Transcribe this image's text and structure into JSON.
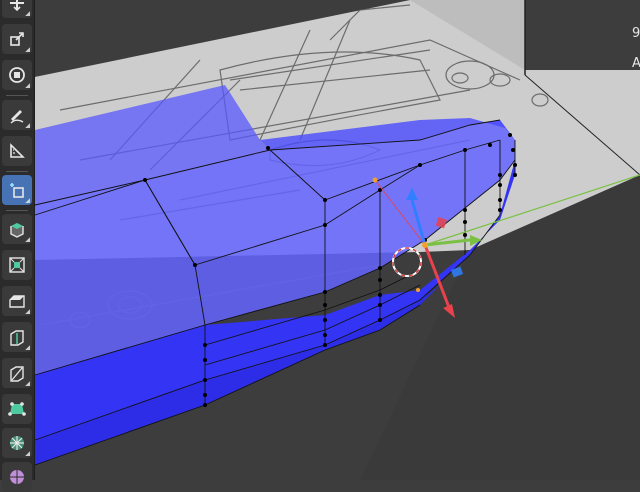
{
  "app": {
    "name": "3D viewport"
  },
  "colors": {
    "viewport_bg": "#3d3d3d",
    "mesh_face": "#3a3aff",
    "mesh_face_light": "#6e6eff",
    "reference_plane": "#cfcfcf",
    "axis_x": "#e8424c",
    "axis_y": "#7ac143",
    "axis_z": "#2f7fff",
    "toolbar_bg": "#2b2b2b",
    "tool_active": "#4772b3"
  },
  "toolbar": {
    "tools": [
      {
        "name": "move-icon",
        "active": false
      },
      {
        "name": "scale-icon",
        "active": false
      },
      {
        "name": "transform-icon",
        "active": false
      },
      {
        "name": "annotate-icon",
        "active": false
      },
      {
        "name": "measure-icon",
        "active": false
      },
      {
        "name": "add-cube-icon",
        "active": true
      },
      {
        "name": "extrude-icon",
        "active": false
      },
      {
        "name": "inset-icon",
        "active": false
      },
      {
        "name": "bevel-icon",
        "active": false
      },
      {
        "name": "loop-cut-icon",
        "active": false
      },
      {
        "name": "knife-icon",
        "active": false
      },
      {
        "name": "poly-build-icon",
        "active": false
      },
      {
        "name": "spin-icon",
        "active": false
      },
      {
        "name": "smooth-icon",
        "active": false
      }
    ]
  },
  "overlay": {
    "right_chars": [
      "9",
      "A"
    ]
  }
}
